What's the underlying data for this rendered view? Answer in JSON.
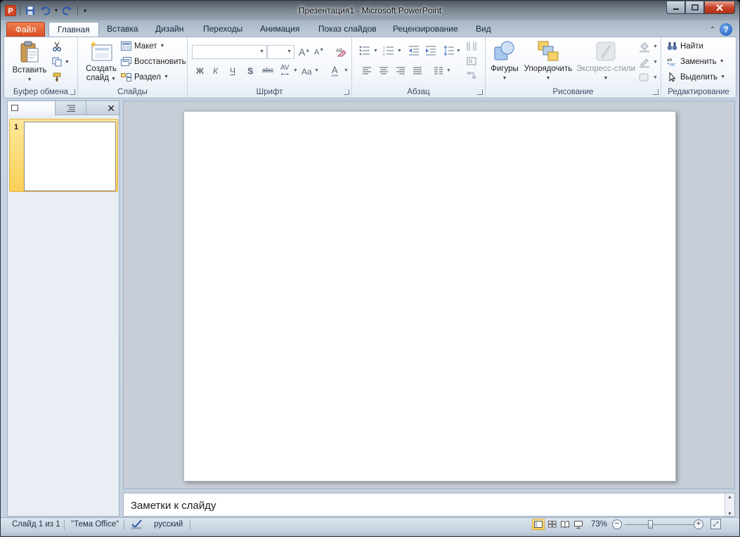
{
  "window": {
    "title": "Презентация1  -  Microsoft PowerPoint",
    "app_logo": "P"
  },
  "quick_access": {
    "icons": [
      "save-icon",
      "undo-icon",
      "redo-icon",
      "customize-icon"
    ]
  },
  "tabs": {
    "file": "Файл",
    "home": "Главная",
    "insert": "Вставка",
    "design": "Дизайн",
    "transitions": "Переходы",
    "animations": "Анимация",
    "slideshow": "Показ слайдов",
    "review": "Рецензирование",
    "view": "Вид"
  },
  "ribbon": {
    "clipboard": {
      "label": "Буфер обмена",
      "paste": "Вставить"
    },
    "slides": {
      "label": "Слайды",
      "new_slide_line1": "Создать",
      "new_slide_line2": "слайд",
      "layout": "Макет",
      "reset": "Восстановить",
      "section": "Раздел"
    },
    "font": {
      "label": "Шрифт",
      "bold": "Ж",
      "italic": "К",
      "underline": "Ч",
      "shadow": "S",
      "strike": "abc",
      "spacing": "AV",
      "case": "Aa",
      "color": "A",
      "grow": "A",
      "shrink": "A"
    },
    "paragraph": {
      "label": "Абзац"
    },
    "drawing": {
      "label": "Рисование",
      "shapes": "Фигуры",
      "arrange": "Упорядочить",
      "quick_styles": "Экспресс-стили"
    },
    "editing": {
      "label": "Редактирование",
      "find": "Найти",
      "replace": "Заменить",
      "select": "Выделить"
    }
  },
  "left_pane": {
    "slide_number": "1"
  },
  "notes": {
    "placeholder": "Заметки к слайду"
  },
  "status": {
    "slide": "Слайд 1 из 1",
    "theme": "\"Тема Office\"",
    "language": "русский",
    "zoom": "73%",
    "zoom_level": 0.36
  },
  "colors": {
    "file_tab": "#d7491f",
    "selection": "#fbd157",
    "ribbon_border": "#9eb0c4"
  }
}
